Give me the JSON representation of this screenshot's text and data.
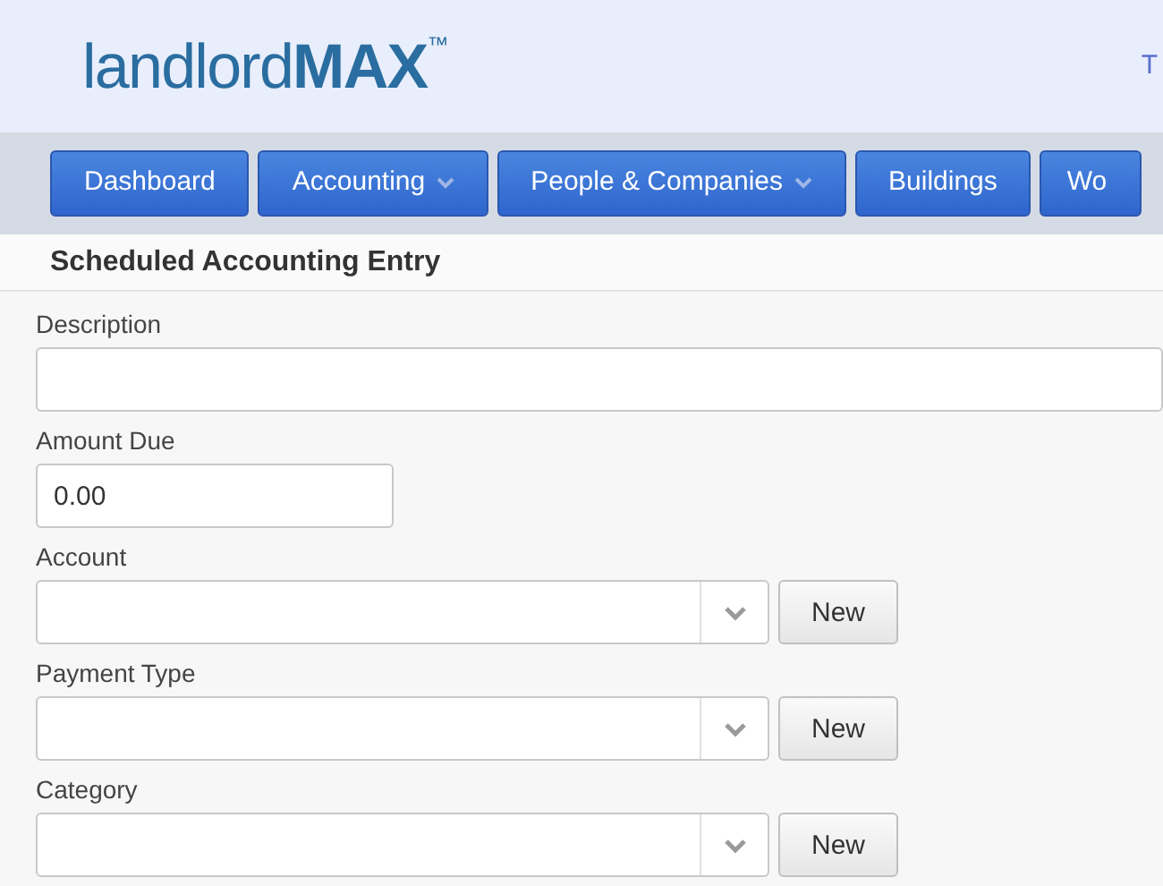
{
  "header": {
    "logo": "landlord**MAX**$^{™}$",
    "corner_text": "T"
  },
  "nav": [
    {
      "label": "Dashboard",
      "dropdown": false
    },
    {
      "label": "Accounting",
      "dropdown": true
    },
    {
      "label": "People & Companies",
      "dropdown": true
    },
    {
      "label": "Buildings",
      "dropdown": false
    },
    {
      "label": "Wo",
      "dropdown": false
    }
  ],
  "page_title": "Scheduled Accounting Entry",
  "form": [
    {
      "kind": "text",
      "label": "Description"
    },
    {
      "kind": "amount",
      "label": "Amount Due",
      "value": "0.00"
    },
    {
      "kind": "select",
      "label": "Account",
      "button": "New"
    },
    {
      "kind": "select",
      "label": "Payment Type",
      "button": "New"
    },
    {
      "kind": "select",
      "label": "Category",
      "button": "New"
    }
  ]
}
